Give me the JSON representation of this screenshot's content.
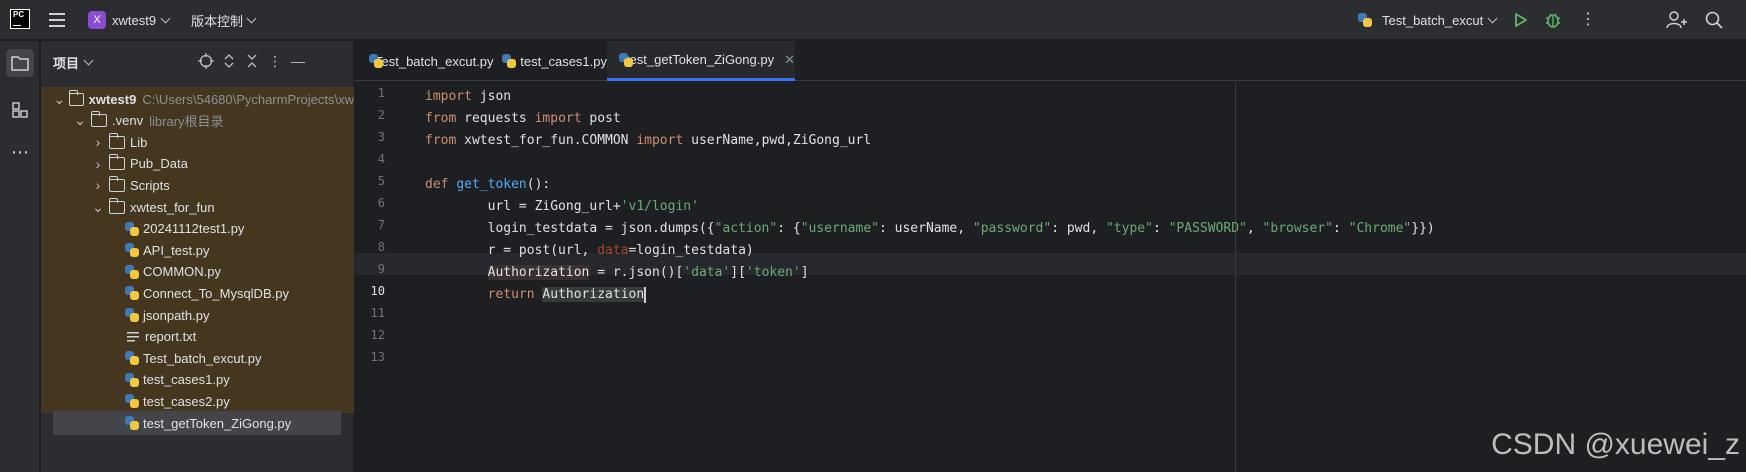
{
  "titlebar": {
    "project_badge": "X",
    "project_name": "xwtest9",
    "vcs_label": "版本控制",
    "run_config": "Test_batch_excut"
  },
  "project_panel": {
    "title": "项目",
    "tree": [
      {
        "label": "xwtest9",
        "hint": "C:\\Users\\54680\\PycharmProjects\\xw",
        "kind": "folder",
        "expanded": true,
        "depth": 0
      },
      {
        "label": ".venv",
        "hint": "library根目录",
        "kind": "folder",
        "expanded": true,
        "depth": 1
      },
      {
        "label": "Lib",
        "kind": "folder",
        "expanded": false,
        "depth": 2
      },
      {
        "label": "Pub_Data",
        "kind": "folder",
        "expanded": false,
        "depth": 2
      },
      {
        "label": "Scripts",
        "kind": "folder",
        "expanded": false,
        "depth": 2
      },
      {
        "label": "xwtest_for_fun",
        "kind": "folder",
        "expanded": true,
        "depth": 2
      },
      {
        "label": "20241112test1.py",
        "kind": "py",
        "depth": 3
      },
      {
        "label": "API_test.py",
        "kind": "py",
        "depth": 3
      },
      {
        "label": "COMMON.py",
        "kind": "py",
        "depth": 3
      },
      {
        "label": "Connect_To_MysqlDB.py",
        "kind": "py",
        "depth": 3
      },
      {
        "label": "jsonpath.py",
        "kind": "py",
        "depth": 3
      },
      {
        "label": "report.txt",
        "kind": "txt",
        "depth": 3
      },
      {
        "label": "Test_batch_excut.py",
        "kind": "py",
        "depth": 3
      },
      {
        "label": "test_cases1.py",
        "kind": "py",
        "depth": 3
      },
      {
        "label": "test_cases2.py",
        "kind": "py",
        "depth": 3
      },
      {
        "label": "test_getToken_ZiGong.py",
        "kind": "py",
        "depth": 3,
        "current": true
      }
    ]
  },
  "editor": {
    "tabs": [
      {
        "label": "Test_batch_excut.py",
        "active": false
      },
      {
        "label": "test_cases1.py",
        "active": false
      },
      {
        "label": "test_getToken_ZiGong.py",
        "active": true
      }
    ],
    "line_numbers": [
      "1",
      "2",
      "3",
      "4",
      "5",
      "6",
      "7",
      "8",
      "9",
      "10",
      "11",
      "12",
      "13"
    ],
    "current_line": "10",
    "code": {
      "l1": [
        "import",
        " json"
      ],
      "l2": [
        "from",
        " requests ",
        "import",
        " post"
      ],
      "l3": [
        "from",
        " xwtest_for_fun.COMMON ",
        "import",
        " userName,pwd,ZiGong_url"
      ],
      "l5": [
        "def",
        " ",
        "get_token",
        "():"
      ],
      "l6": [
        "        url = ZiGong_url+",
        "'v1/login'"
      ],
      "l7": [
        "        login_testdata = json.dumps({",
        "\"action\"",
        ": {",
        "\"username\"",
        ": userName, ",
        "\"password\"",
        ": pwd, ",
        "\"type\"",
        ": ",
        "\"PASSWORD\"",
        ", ",
        "\"browser\"",
        ": ",
        "\"Chrome\"",
        "}})"
      ],
      "l8": [
        "        r = post(url, ",
        "data",
        "=login_testdata)"
      ],
      "l9": [
        "        ",
        "Authorization",
        " = r.json()[",
        "'data'",
        "][",
        "'token'",
        "]"
      ],
      "l10": [
        "        ",
        "return",
        " ",
        "Authorization"
      ]
    }
  },
  "watermark": "CSDN @xuewei_z"
}
